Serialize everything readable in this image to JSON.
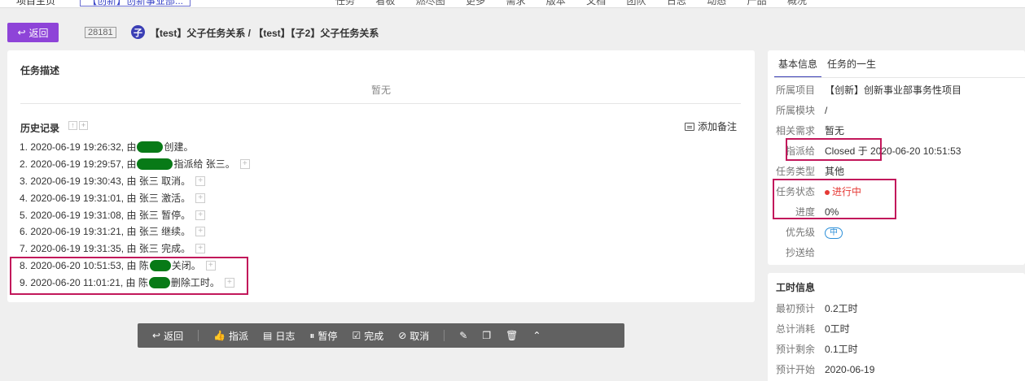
{
  "topbar": {
    "crumb_left": "项目主页",
    "crumb_project": "【创新】创新事业部...",
    "nav": [
      "任务",
      "看板",
      "燃尽图",
      "更多",
      "需求",
      "版本",
      "文档",
      "团队",
      "日志",
      "动态",
      "产品",
      "概况"
    ]
  },
  "header": {
    "back_label": "返回",
    "task_id": "28181",
    "type_badge": "子",
    "title": "【test】父子任务关系 / 【test】【子2】父子任务关系"
  },
  "main": {
    "desc_title": "任务描述",
    "desc_empty": "暂无",
    "history_title": "历史记录",
    "add_note_label": "添加备注",
    "history": [
      {
        "pre": "1. 2020-06-19 19:26:32, 由 ",
        "post": " 创建。"
      },
      {
        "pre": "2. 2020-06-19 19:29:57, 由 ",
        "post": "指派给 张三。"
      },
      {
        "pre": "3. 2020-06-19 19:30:43, 由 张三 取消。",
        "post": ""
      },
      {
        "pre": "4. 2020-06-19 19:31:01, 由 张三 激活。",
        "post": ""
      },
      {
        "pre": "5. 2020-06-19 19:31:08, 由 张三 暂停。",
        "post": ""
      },
      {
        "pre": "6. 2020-06-19 19:31:21, 由 张三 继续。",
        "post": ""
      },
      {
        "pre": "7. 2020-06-19 19:31:35, 由 张三 完成。",
        "post": ""
      },
      {
        "pre": "8. 2020-06-20 10:51:53, 由 陈",
        "post": " 关闭。"
      },
      {
        "pre": "9. 2020-06-20 11:01:21, 由 陈",
        "post": " 删除工时。"
      }
    ]
  },
  "toolbar": {
    "back": "返回",
    "assign": "指派",
    "log": "日志",
    "pause": "暂停",
    "finish": "完成",
    "cancel": "取消"
  },
  "side": {
    "tab_basic": "基本信息",
    "tab_life": "任务的一生",
    "rows": {
      "project": {
        "label": "所属项目",
        "value": "【创新】创新事业部事务性项目"
      },
      "module": {
        "label": "所属模块",
        "value": "/"
      },
      "story": {
        "label": "相关需求",
        "value": "暂无"
      },
      "assigned": {
        "label": "指派给",
        "value": "Closed 于 2020-06-20 10:51:53"
      },
      "type": {
        "label": "任务类型",
        "value": "其他"
      },
      "status": {
        "label": "任务状态",
        "value": "进行中"
      },
      "progress": {
        "label": "进度",
        "value": "0%"
      },
      "priority": {
        "label": "优先级",
        "value": "中"
      },
      "cc": {
        "label": "抄送给",
        "value": ""
      }
    }
  },
  "time": {
    "title": "工时信息",
    "rows": {
      "estimate": {
        "label": "最初预计",
        "value": "0.2工时"
      },
      "consumed": {
        "label": "总计消耗",
        "value": "0工时"
      },
      "left": {
        "label": "预计剩余",
        "value": "0.1工时"
      },
      "start": {
        "label": "预计开始",
        "value": "2020-06-19"
      }
    }
  },
  "colors": {
    "accent": "#3b3fb5",
    "back_button": "#8e44d8",
    "highlight_box": "#c2185b",
    "status_red": "#e53935",
    "toolbar_bg": "#616161"
  }
}
